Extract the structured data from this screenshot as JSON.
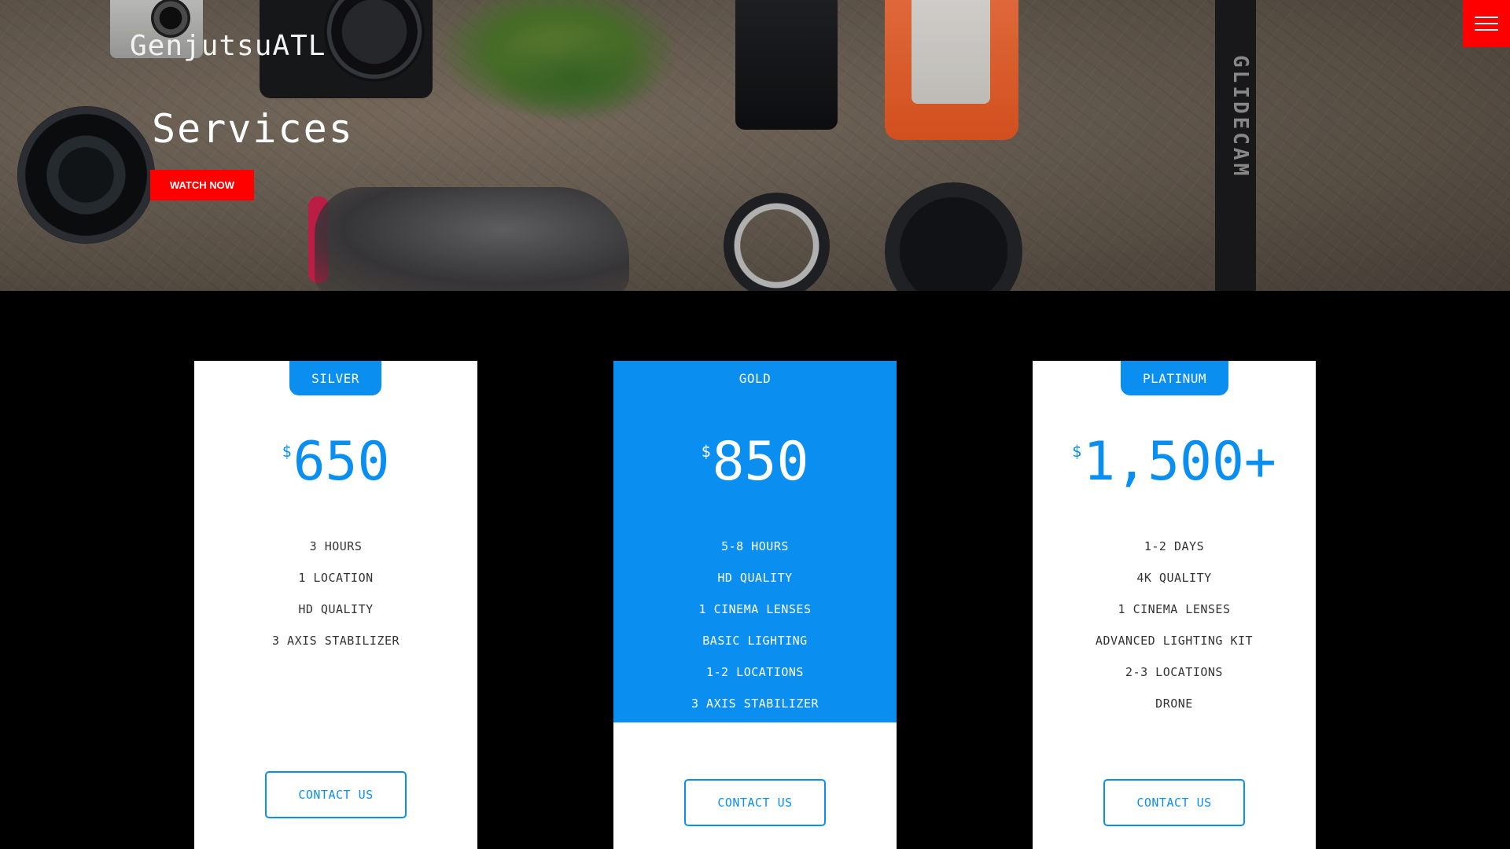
{
  "header": {
    "brand": "GenjutsuATL",
    "page_title": "Services",
    "watch_button": "WATCH NOW",
    "menu_icon": "hamburger-menu-icon",
    "strap_text": "GLIDECAM"
  },
  "colors": {
    "accent": "#0a8ff0",
    "cta_red": "#ff0000",
    "background": "#000000"
  },
  "pricing": [
    {
      "tier": "SILVER",
      "currency": "$",
      "price": "650",
      "features": [
        "3 HOURS",
        "1 LOCATION",
        "HD QUALITY",
        "3 AXIS STABILIZER"
      ],
      "cta": "CONTACT US"
    },
    {
      "tier": "GOLD",
      "currency": "$",
      "price": "850",
      "features": [
        "5-8 HOURS",
        "HD QUALITY",
        "1 CINEMA LENSES",
        "BASIC LIGHTING",
        "1-2 LOCATIONS",
        "3 AXIS STABILIZER"
      ],
      "cta": "CONTACT US"
    },
    {
      "tier": "PLATINUM",
      "currency": "$",
      "price": "1,500+",
      "features": [
        "1-2 DAYS",
        "4K QUALITY",
        "1 CINEMA LENSES",
        "ADVANCED LIGHTING KIT",
        "2-3 LOCATIONS",
        "DRONE"
      ],
      "cta": "CONTACT US"
    }
  ]
}
